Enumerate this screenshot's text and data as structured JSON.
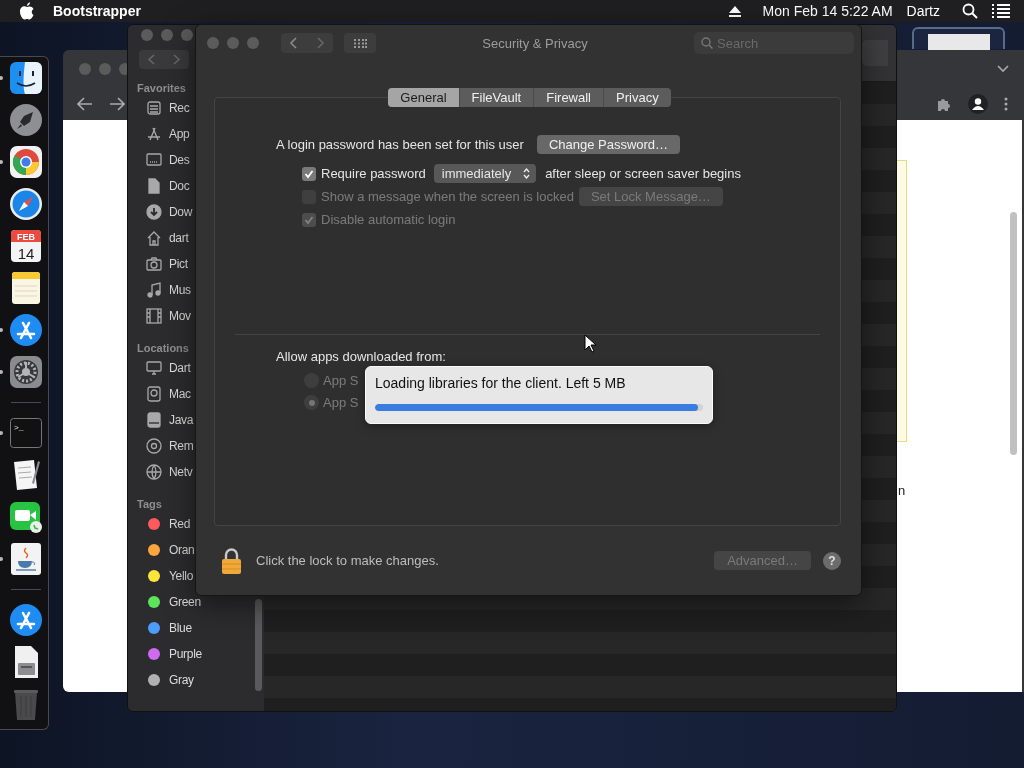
{
  "menu_bar": {
    "app_name": "Bootstrapper",
    "clock": "Mon Feb 14  5:22 AM",
    "user": "Dartz"
  },
  "dock": {
    "items": [
      {
        "kind": "finder",
        "running": true
      },
      {
        "kind": "launchpad",
        "running": false
      },
      {
        "kind": "chrome",
        "running": true
      },
      {
        "kind": "safari",
        "running": false
      },
      {
        "kind": "calendar",
        "running": false,
        "month": "FEB",
        "day": "14"
      },
      {
        "kind": "notes",
        "running": false
      },
      {
        "kind": "appstore",
        "running": true
      },
      {
        "kind": "settings",
        "running": true
      },
      {
        "kind": "separator"
      },
      {
        "kind": "terminal",
        "running": true,
        "prompt": ">_"
      },
      {
        "kind": "textedit",
        "running": false
      },
      {
        "kind": "facetime",
        "running": false
      },
      {
        "kind": "java",
        "running": true
      },
      {
        "kind": "separator"
      },
      {
        "kind": "appstore",
        "running": false
      },
      {
        "kind": "installer",
        "running": false
      },
      {
        "kind": "trash",
        "running": false
      }
    ]
  },
  "browser": {
    "page_text": "n"
  },
  "finder": {
    "sidebar": [
      {
        "heading": "Favorites",
        "items": [
          {
            "kind": "recents",
            "label": "Rec"
          },
          {
            "kind": "applications",
            "label": "App"
          },
          {
            "kind": "desktop",
            "label": "Des"
          },
          {
            "kind": "documents",
            "label": "Doc"
          },
          {
            "kind": "downloads",
            "label": "Dow"
          },
          {
            "kind": "home",
            "label": "dart"
          },
          {
            "kind": "pictures",
            "label": "Pict"
          },
          {
            "kind": "music",
            "label": "Mus"
          },
          {
            "kind": "movies",
            "label": "Mov"
          }
        ]
      },
      {
        "heading": "Locations",
        "items": [
          {
            "kind": "computer",
            "label": "Dart"
          },
          {
            "kind": "disk",
            "label": "Mac"
          },
          {
            "kind": "drive",
            "label": "Java"
          },
          {
            "kind": "remote",
            "label": "Rem"
          },
          {
            "kind": "network",
            "label": "Netv"
          }
        ]
      },
      {
        "heading": "Tags",
        "items": [
          {
            "kind": "tag",
            "label": "Red",
            "color": "#fe5a5e"
          },
          {
            "kind": "tag",
            "label": "Oran",
            "color": "#fda43c"
          },
          {
            "kind": "tag",
            "label": "Yello",
            "color": "#fde43b"
          },
          {
            "kind": "tag",
            "label": "Green",
            "color": "#5ee45b"
          },
          {
            "kind": "tag",
            "label": "Blue",
            "color": "#4d9bfa"
          },
          {
            "kind": "tag",
            "label": "Purple",
            "color": "#cf6bf0"
          },
          {
            "kind": "tag",
            "label": "Gray",
            "color": "#b0b0b2"
          }
        ]
      }
    ]
  },
  "preferences": {
    "title": "Security & Privacy",
    "search": {
      "placeholder": "Search"
    },
    "tabs": [
      {
        "label": "General",
        "selected": true
      },
      {
        "label": "FileVault",
        "selected": false
      },
      {
        "label": "Firewall",
        "selected": false
      },
      {
        "label": "Privacy",
        "selected": false
      }
    ],
    "password_note": "A login password has been set for this user",
    "change_password_button": "Change Password…",
    "options": [
      {
        "label": "Require password",
        "checked": true,
        "disabled": false,
        "popup": "immediately",
        "suffix": "after sleep or screen saver begins"
      },
      {
        "label": "Show a message when the screen is locked",
        "checked": false,
        "disabled": true,
        "button": "Set Lock Message…"
      },
      {
        "label": "Disable automatic login",
        "checked": true,
        "disabled": true
      }
    ],
    "downloads_heading": "Allow apps downloaded from:",
    "download_sources": [
      {
        "label": "App S",
        "selected": false,
        "disabled": true
      },
      {
        "label": "App S",
        "selected": true,
        "disabled": true
      }
    ],
    "lock_note": "Click the lock to make changes.",
    "advanced_button": {
      "label": "Advanced…",
      "disabled": true
    },
    "help_button": "?"
  },
  "loading_popup": {
    "message": "Loading libraries for the client. Left 5 MB",
    "level": 0.985
  }
}
